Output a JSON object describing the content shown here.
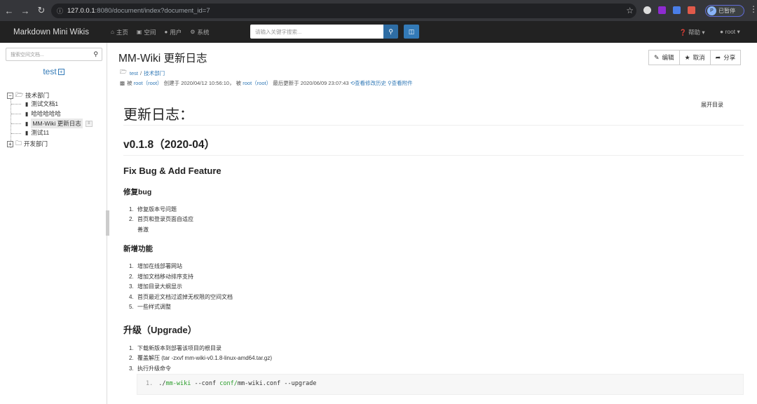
{
  "browser": {
    "url_host": "127.0.0.1",
    "url_path": ":8080/document/index?document_id=7",
    "profile_initial": "P",
    "profile_label": "已暂停"
  },
  "navbar": {
    "brand": "Markdown Mini Wikis",
    "items": [
      {
        "icon": "home-icon",
        "label": "主页"
      },
      {
        "icon": "cube-icon",
        "label": "空间"
      },
      {
        "icon": "user-icon",
        "label": "用户"
      },
      {
        "icon": "gear-icon",
        "label": "系统"
      }
    ],
    "search_placeholder": "请输入关键字搜索...",
    "help_label": "帮助",
    "user_label": "root"
  },
  "sidebar": {
    "search_placeholder": "搜索空间文档...",
    "space_title": "test",
    "tree": [
      {
        "label": "技术部门",
        "type": "folder",
        "expanded": true
      },
      {
        "label": "测试文档1",
        "type": "doc"
      },
      {
        "label": "哈哈哈哈哈",
        "type": "doc"
      },
      {
        "label": "MM-Wiki 更新日志",
        "type": "doc",
        "selected": true
      },
      {
        "label": "测试11",
        "type": "doc"
      },
      {
        "label": "开发部门",
        "type": "folder",
        "expanded": false
      }
    ]
  },
  "document": {
    "title": "MM-Wiki 更新日志",
    "actions": [
      {
        "icon": "pencil-icon",
        "label": "编辑"
      },
      {
        "icon": "star-icon",
        "label": "取消"
      },
      {
        "icon": "share-icon",
        "label": "分享"
      }
    ],
    "breadcrumb": [
      "test",
      "技术部门"
    ],
    "meta": {
      "by": "被",
      "creator": "root（root）",
      "created_prefix": "创建于",
      "created_at": "2020/04/12 10:56:10",
      "comma": "，",
      "by2": "被",
      "editor": "root（root）",
      "updated_prefix": "最后更新于",
      "updated_at": "2020/06/09 23:07:43",
      "history_label": "查看修改历史",
      "attach_label": "查看附件"
    },
    "toc_label": "展开目录"
  },
  "content": {
    "h1": "更新日志：",
    "h2": "v0.1.8（2020-04）",
    "section1": "Fix Bug & Add Feature",
    "sub1": "修复bug",
    "sub1_items": [
      "修复版本号问题",
      "首页和登录页面自适应"
    ],
    "sub1_item2_cont": "善澈",
    "sub2": "新增功能",
    "sub2_items": [
      "增加在线部署网站",
      "增加文档移动排序支持",
      "增加目录大纲显示",
      "首页最近文档过滤掉无权限的空间文档",
      "一些样式调整"
    ],
    "section2": "升级（Upgrade）",
    "upgrade_items": [
      "下载新版本到部署该项目的根目录",
      "覆盖解压 (tar -zxvf mm-wiki-v0.1.8-linux-amd64.tar.gz)",
      "执行升级命令"
    ],
    "code": {
      "line_no": "1.",
      "t1": "./",
      "t2": "mm-wiki",
      "t3": " --conf ",
      "t4": "conf/",
      "t5": "mm-wiki.conf --upgrade"
    }
  }
}
